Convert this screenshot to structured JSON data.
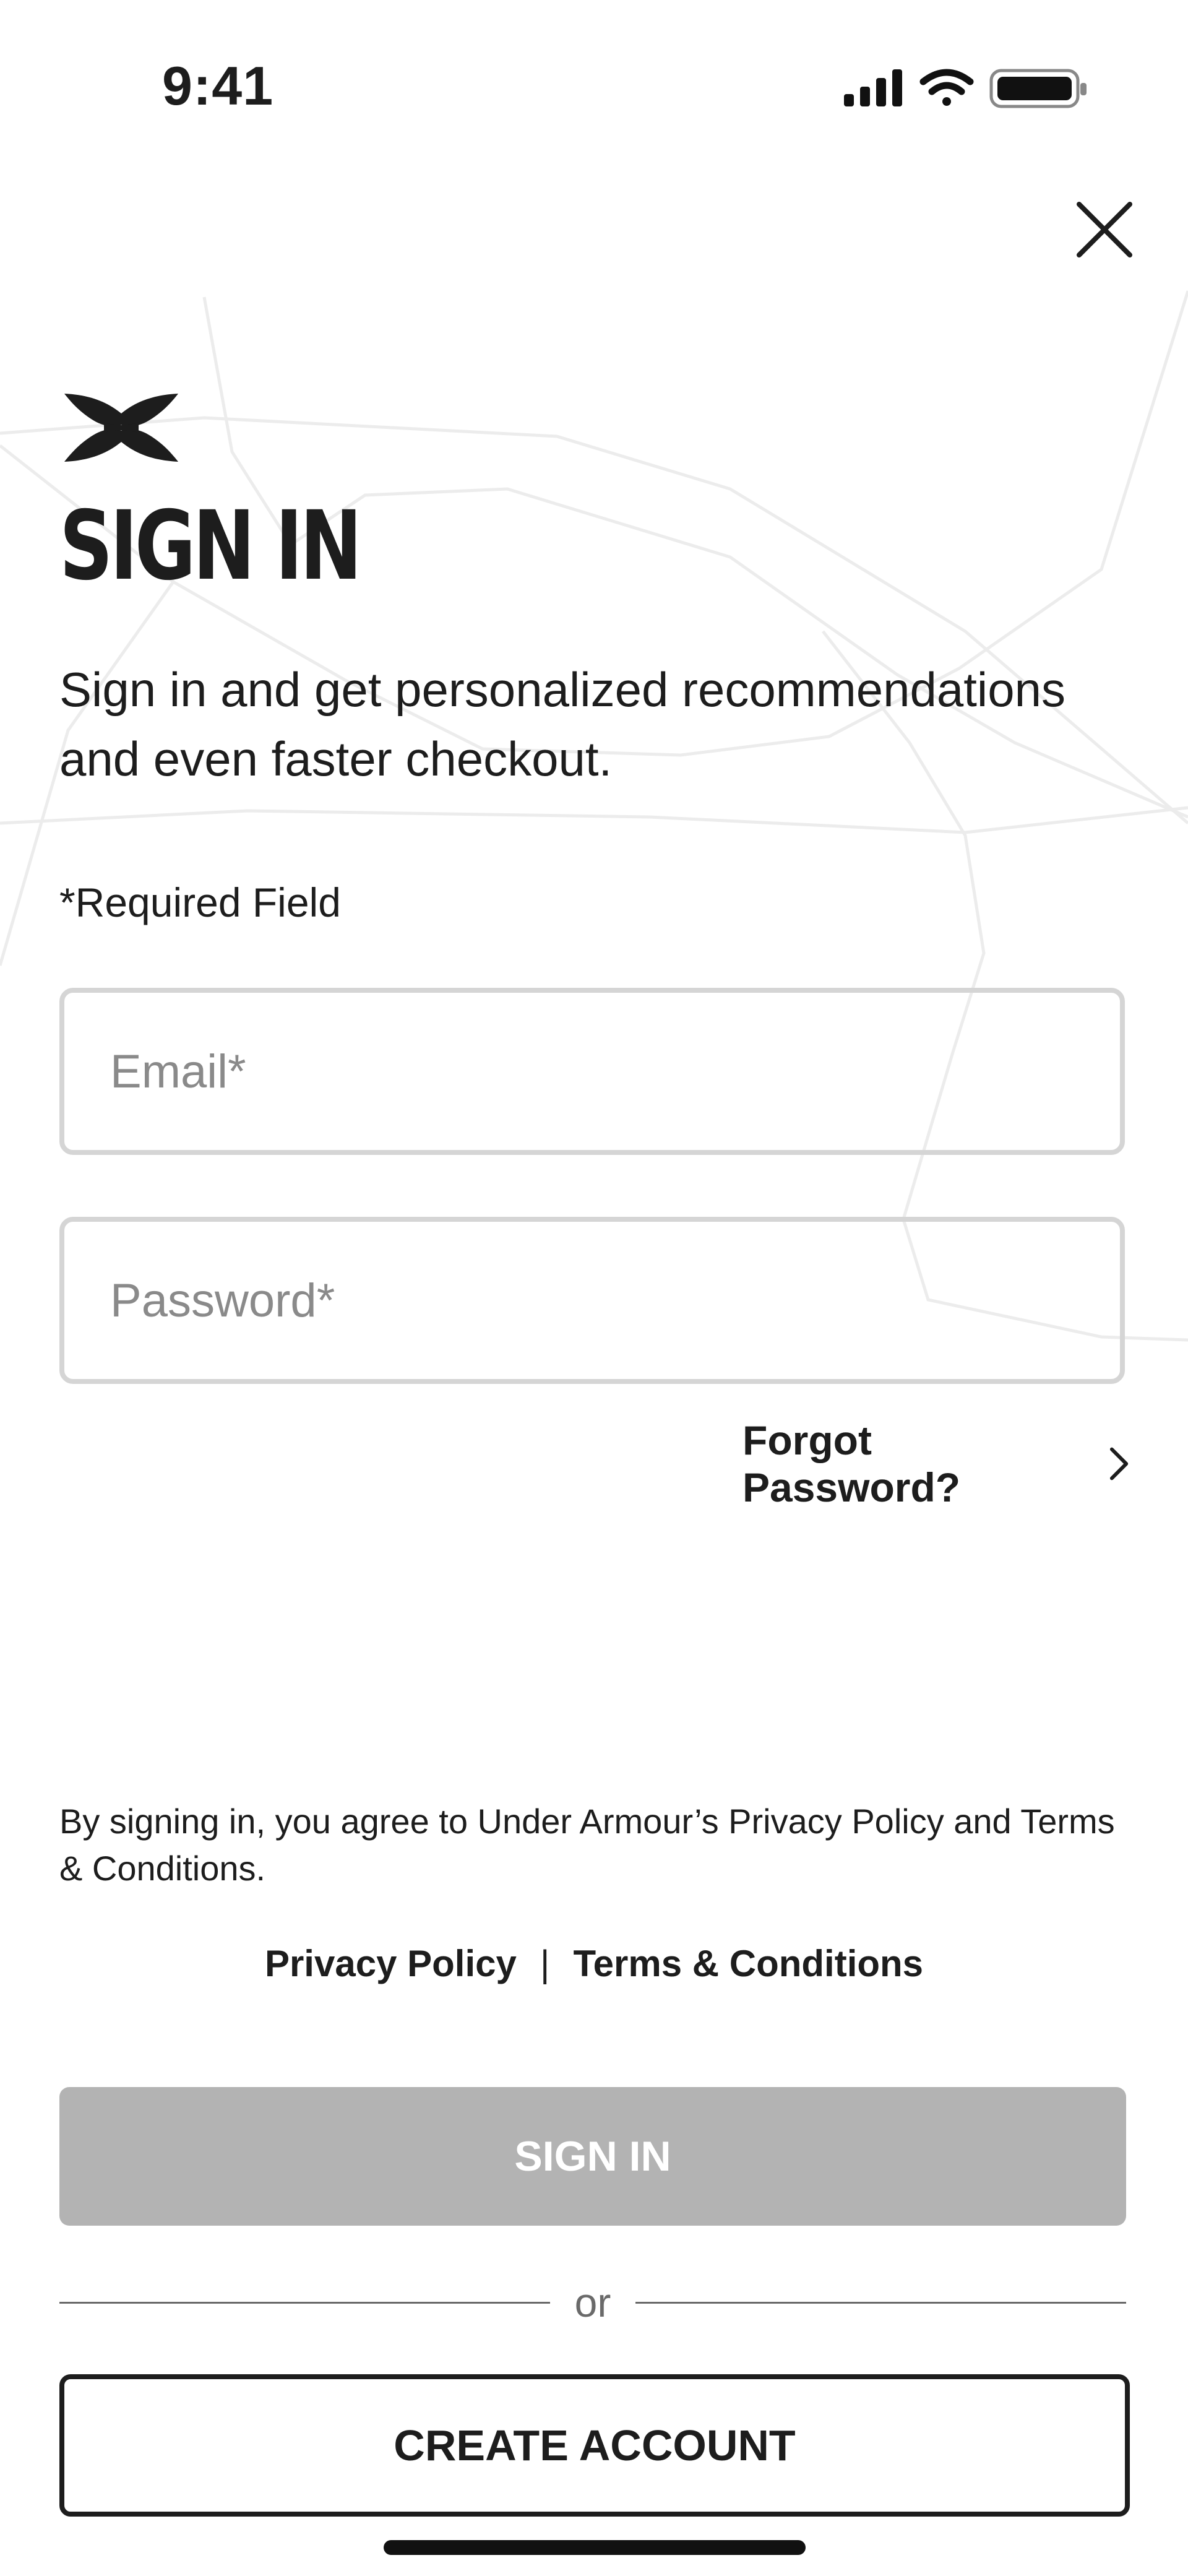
{
  "status_bar": {
    "time": "9:41",
    "icons": [
      "cellular-signal-icon",
      "wifi-icon",
      "battery-icon"
    ]
  },
  "header": {
    "close_icon": "close-icon",
    "logo_icon": "under-armour-logo-icon"
  },
  "main": {
    "title": "SIGN IN",
    "subtitle": "Sign in and get personalized recommendations and even faster checkout.",
    "required_note": "*Required Field",
    "email_placeholder": "Email*",
    "email_value": "",
    "password_placeholder": "Password*",
    "password_value": "",
    "forgot_password_label": "Forgot Password?",
    "forgot_icon": "chevron-right-icon"
  },
  "footer": {
    "agreement_text": "By signing in, you agree to Under Armour’s Privacy Policy and Terms & Conditions.",
    "privacy_link": "Privacy Policy",
    "separator": "|",
    "terms_link": "Terms & Conditions",
    "sign_in_button": "SIGN IN",
    "or_text": "or",
    "create_account_button": "CREATE ACCOUNT"
  },
  "colors": {
    "text": "#1d1d1d",
    "disabled_button": "#b3b3b3",
    "field_border": "#d5d5d5",
    "placeholder": "#8a8a8a"
  }
}
